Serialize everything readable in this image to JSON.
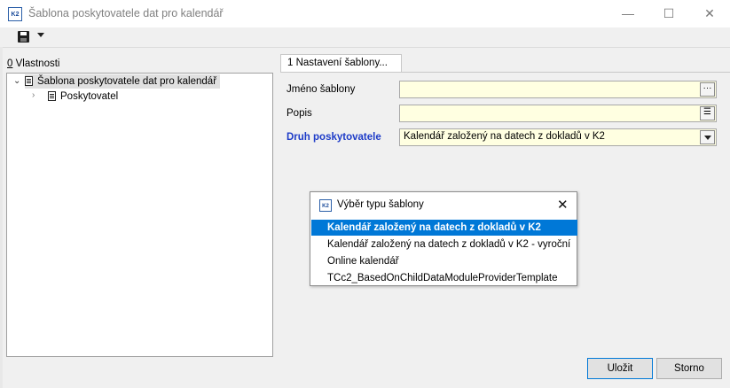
{
  "window": {
    "title": "Šablona poskytovatele dat pro kalendář",
    "app_icon_label": "K2",
    "minimize_glyph": "—",
    "maximize_glyph": "☐",
    "close_glyph": "✕"
  },
  "toolbar": {
    "save_icon": "save-icon",
    "dropdown_icon": "chevron-down-icon"
  },
  "properties": {
    "label_hotkey": "0",
    "label_rest": " Vlastnosti",
    "tree": {
      "root": "Šablona poskytovatele dat pro kalendář",
      "child": "Poskytovatel"
    }
  },
  "tabs": [
    {
      "label": "1 Nastavení šablony..."
    }
  ],
  "form": {
    "template_name_label": "Jméno šablony",
    "template_name_value": "",
    "description_label": "Popis",
    "description_value": "",
    "provider_type_label": "Druh poskytovatele",
    "provider_type_value": "Kalendář založený na datech z dokladů v K2",
    "provider_type_color": "#1e3cc8"
  },
  "popup": {
    "title": "Výběr typu šablony",
    "icon_label": "K2",
    "close_glyph": "✕",
    "options": [
      "Kalendář založený na datech z dokladů v K2",
      "Kalendář založený na datech z dokladů v K2 - vyroční",
      "Online kalendář",
      "TCc2_BasedOnChildDataModuleProviderTemplate"
    ],
    "selected_index": 0,
    "selection_color": "#0078d7"
  },
  "buttons": {
    "ok": "Uložit",
    "cancel": "Storno"
  }
}
